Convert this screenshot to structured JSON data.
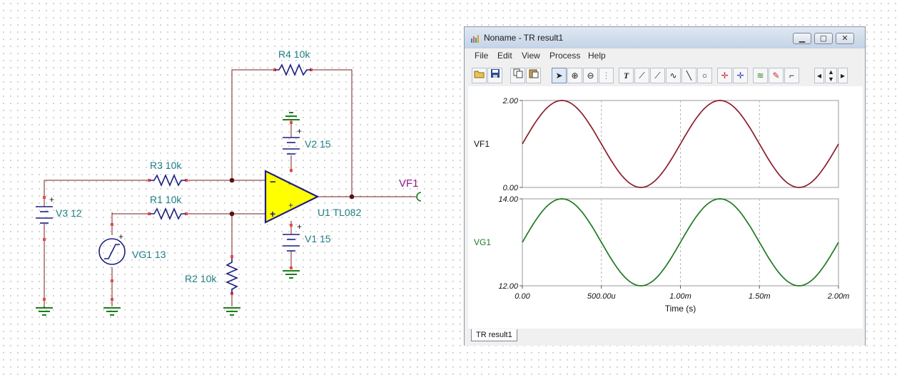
{
  "schematic": {
    "components": {
      "r4": "R4 10k",
      "r3": "R3 10k",
      "r1": "R1 10k",
      "r2": "R2 10k",
      "v3": "V3 12",
      "vg1": "VG1 13",
      "v2": "V2 15",
      "v1": "V1 15",
      "u1": "U1 TL082"
    },
    "output_label": "VF1",
    "colors": {
      "wire": "#7a1d1d",
      "ground": "#1b7d1b",
      "opamp_fill": "#ffff00",
      "label": "#1c7f86",
      "output_label": "#8b1a8b"
    }
  },
  "window": {
    "title": "Noname - TR result1",
    "menu": [
      "File",
      "Edit",
      "View",
      "Process",
      "Help"
    ],
    "toolbar_icons": [
      "open-folder-icon",
      "save-icon",
      "copy-icon",
      "paste-icon",
      "pointer-icon",
      "zoom-in-icon",
      "zoom-100-icon",
      "grid-icon",
      "text-tool-icon",
      "cursor-a-icon",
      "cursor-b-icon",
      "curve-icon",
      "line-icon",
      "circle-icon",
      "marker-a-icon",
      "marker-b-icon",
      "waveform-icon",
      "probe-icon",
      "step-icon",
      "scroll-left-icon",
      "scroll-updown-icon",
      "scroll-right-icon"
    ],
    "tab_label": "TR result1"
  },
  "chart_data": {
    "type": "line",
    "xlabel": "Time (s)",
    "x_ticks": [
      "0.00",
      "500.00u",
      "1.00m",
      "1.50m",
      "2.00m"
    ],
    "xlim": [
      0,
      0.002
    ],
    "grid": true,
    "panels": [
      {
        "name": "VF1",
        "color": "#8b1f2a",
        "ylim": [
          0,
          2
        ],
        "y_ticks": [
          "2.00",
          "0.00"
        ],
        "x": [
          0,
          0.00025,
          0.0005,
          0.00075,
          0.001,
          0.00125,
          0.0015,
          0.00175,
          0.002
        ],
        "values": [
          1,
          2,
          1,
          0,
          1,
          2,
          1,
          0,
          1
        ]
      },
      {
        "name": "VG1",
        "color": "#1f7a1f",
        "ylim": [
          12,
          14
        ],
        "y_ticks": [
          "14.00",
          "12.00"
        ],
        "x": [
          0,
          0.00025,
          0.0005,
          0.00075,
          0.001,
          0.00125,
          0.0015,
          0.00175,
          0.002
        ],
        "values": [
          13,
          14,
          13,
          12,
          13,
          14,
          13,
          12,
          13
        ]
      }
    ]
  }
}
